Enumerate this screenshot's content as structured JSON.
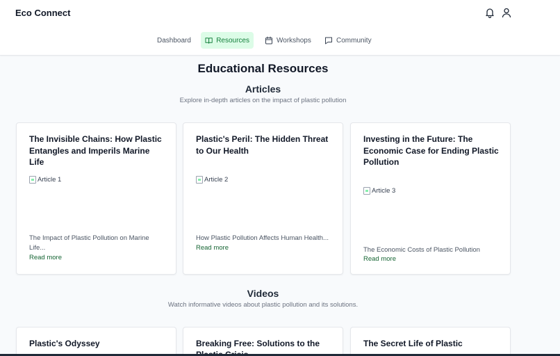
{
  "app": {
    "title": "Eco Connect"
  },
  "nav": [
    {
      "label": "Dashboard",
      "icon": "none",
      "active": false
    },
    {
      "label": "Resources",
      "icon": "book-icon",
      "active": true
    },
    {
      "label": "Workshops",
      "icon": "calendar-icon",
      "active": false
    },
    {
      "label": "Community",
      "icon": "chat-icon",
      "active": false
    }
  ],
  "page": {
    "title": "Educational Resources"
  },
  "articles": {
    "heading": "Articles",
    "subtitle": "Explore in-depth articles on the impact of plastic pollution",
    "items": [
      {
        "title": "The Invisible Chains: How Plastic Entangles and Imperils Marine Life",
        "image_alt": "Article 1",
        "description": "The Impact of Plastic Pollution on Marine Life...",
        "link": "Read more"
      },
      {
        "title": "Plastic's Peril: The Hidden Threat to Our Health",
        "image_alt": "Article 2",
        "description": "How Plastic Pollution Affects Human Health...",
        "link": "Read more"
      },
      {
        "title": "Investing in the Future: The Economic Case for Ending Plastic Pollution",
        "image_alt": "Article 3",
        "description": "The Economic Costs of Plastic Pollution",
        "link": "Read more"
      }
    ]
  },
  "videos": {
    "heading": "Videos",
    "subtitle": "Watch informative videos about plastic pollution and its solutions.",
    "items": [
      {
        "title": "Plastic's Odyssey"
      },
      {
        "title": "Breaking Free: Solutions to the Plastic Crisis"
      },
      {
        "title": "The Secret Life of Plastic"
      }
    ]
  },
  "colors": {
    "accent": "#15803d",
    "accent_bg": "#dcfce7",
    "link": "#166534",
    "page_bg": "#f8fafc"
  }
}
